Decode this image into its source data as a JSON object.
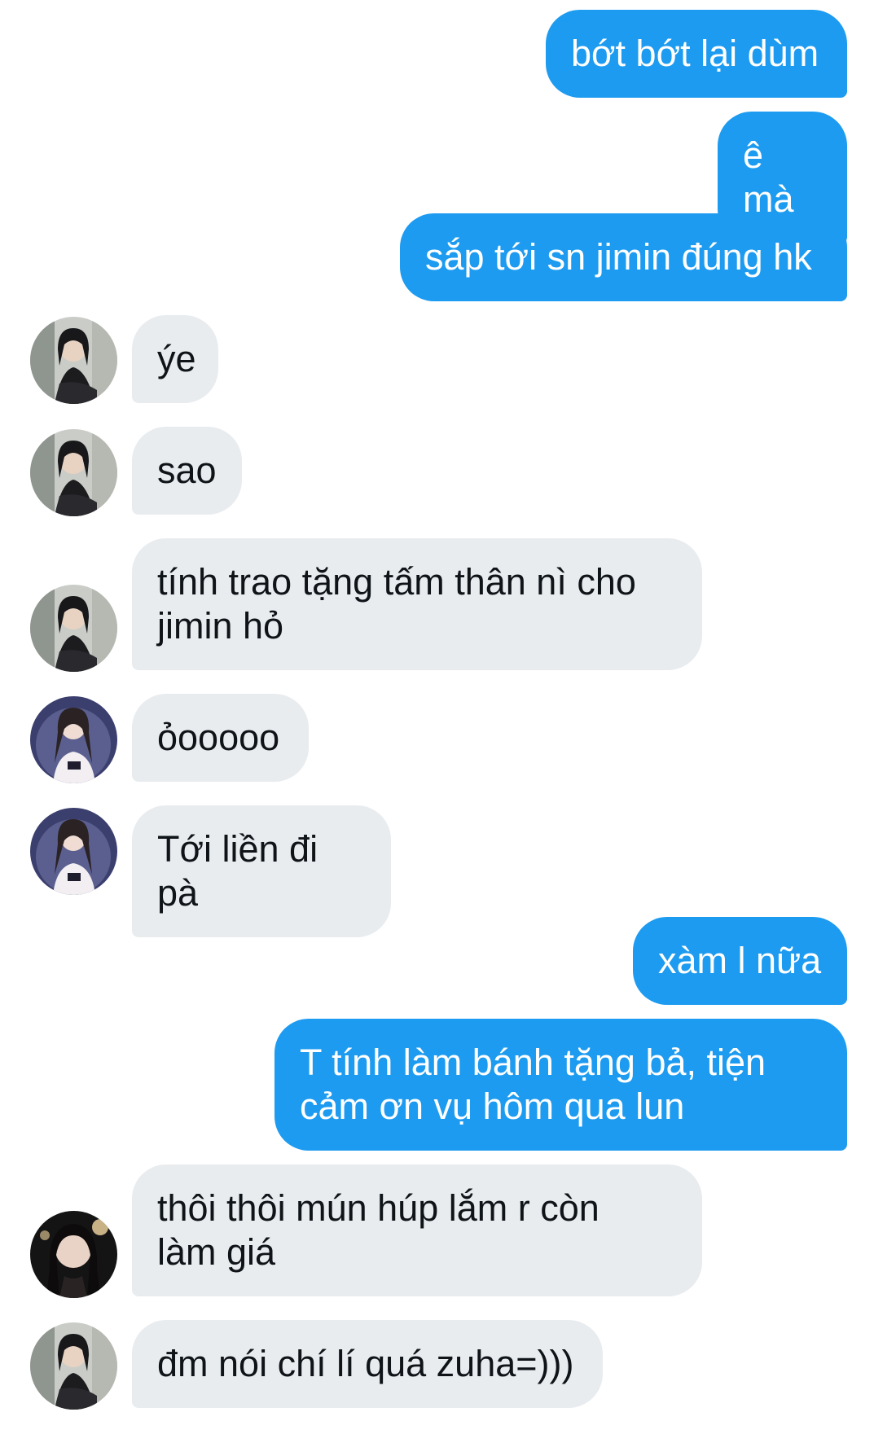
{
  "messages": [
    {
      "side": "out",
      "text": "bớt bớt lại dùm"
    },
    {
      "side": "out",
      "text": "ê mà"
    },
    {
      "side": "out",
      "text": "sắp tới sn jimin đúng hk"
    },
    {
      "side": "in",
      "avatar": "profile-photo-a",
      "text": "ýe"
    },
    {
      "side": "in",
      "avatar": "profile-photo-a",
      "text": "sao"
    },
    {
      "side": "in",
      "avatar": "profile-photo-a",
      "text": "tính trao tặng tấm thân nì cho\njimin hỏ"
    },
    {
      "side": "in",
      "avatar": "profile-photo-b",
      "text": "ỏooooo"
    },
    {
      "side": "in",
      "avatar": "profile-photo-b",
      "text": "Tới liền đi pà"
    },
    {
      "side": "out",
      "text": "xàm l nữa"
    },
    {
      "side": "out",
      "text": "T tính làm bánh tặng bả, tiện\ncảm ơn vụ hôm qua lun"
    },
    {
      "side": "in",
      "avatar": "profile-photo-c",
      "text": "thôi thôi mún húp lắm r còn\nlàm giá"
    },
    {
      "side": "in",
      "avatar": "profile-photo-a",
      "text": "đm nói chí lí quá zuha=)))"
    }
  ],
  "colors": {
    "outgoing_bubble": "#1d9bf0",
    "outgoing_text": "#ffffff",
    "incoming_bubble": "#e9ecef",
    "incoming_text": "#0f1419"
  }
}
